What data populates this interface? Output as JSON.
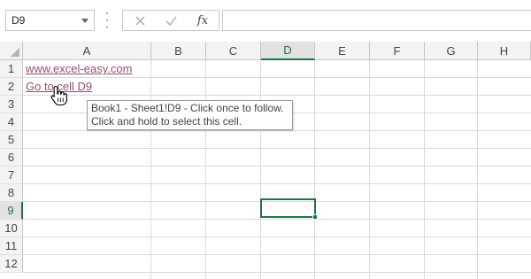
{
  "formula_bar": {
    "name_box": "D9",
    "fx_label": "fx",
    "formula_value": ""
  },
  "sheet": {
    "columns": [
      "A",
      "B",
      "C",
      "D",
      "E",
      "F",
      "G",
      "H"
    ],
    "rows": [
      "1",
      "2",
      "3",
      "4",
      "5",
      "6",
      "7",
      "8",
      "9",
      "10",
      "11",
      "12"
    ],
    "active_cell": "D9",
    "cells": {
      "A1": "www.excel-easy.com",
      "A2": "Go to cell D9"
    },
    "hyperlink_color": "#954f72",
    "selection_color": "#217346"
  },
  "tooltip": {
    "line1": "Book1 - Sheet1!D9 - Click once to follow.",
    "line2": "Click and hold to select this cell."
  },
  "cursor": "hand-pointer-icon"
}
